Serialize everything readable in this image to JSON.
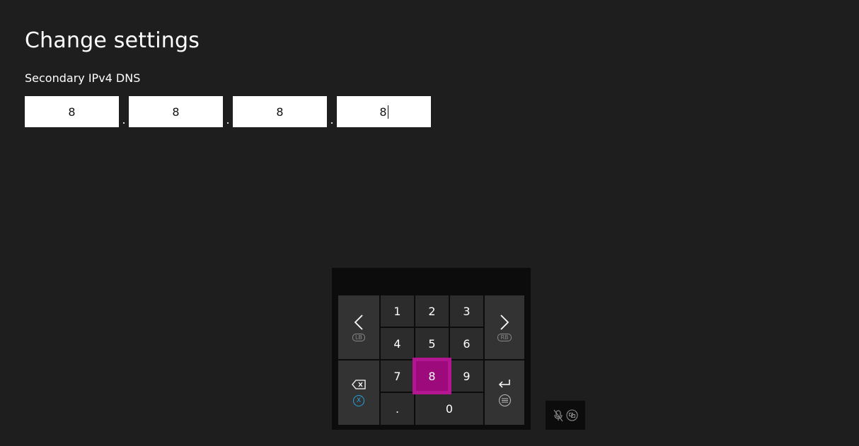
{
  "header": {
    "title": "Change settings"
  },
  "field": {
    "label": "Secondary IPv4 DNS",
    "octets": [
      "8",
      "8",
      "8",
      "8"
    ],
    "separator": "."
  },
  "keypad": {
    "digits": {
      "k1": "1",
      "k2": "2",
      "k3": "3",
      "k4": "4",
      "k5": "5",
      "k6": "6",
      "k7": "7",
      "k8": "8",
      "k9": "9",
      "k0": "0",
      "dot": "."
    },
    "selected_key": "8",
    "left_hint": "LB",
    "right_hint": "RB",
    "clear_hint": "X",
    "icons": {
      "left": "chevron-left-icon",
      "right": "chevron-right-icon",
      "backspace": "backspace-icon",
      "enter": "enter-icon",
      "menu": "menu-button-icon"
    },
    "colors": {
      "selected": "#9d0a7c",
      "selected_border": "#b41590",
      "x_button": "#2aa0d8"
    }
  },
  "mic_panel": {
    "icons": [
      "mic-muted-icon",
      "view-button-icon"
    ]
  }
}
